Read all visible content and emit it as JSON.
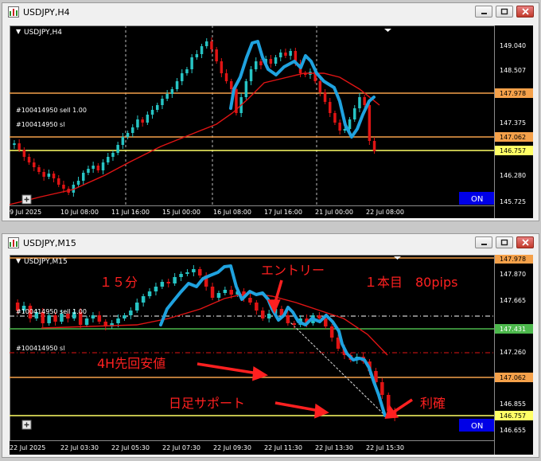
{
  "colors": {
    "accent_line": "#1fa2df",
    "bull": "#27c4c4",
    "bear": "#e01414",
    "ma": "#e01414",
    "price_orange": "#f5a14a",
    "price_yellow": "#ffff66",
    "price_green": "#4cb84c",
    "on_button": "#0000e6"
  },
  "window_top": {
    "title": "USDJPY,H4",
    "label": "USDJPY,H4",
    "order_label": "#100414950 sell 1.00",
    "sl_label": "#100414950 sl",
    "on_button": "ON",
    "price_axis": [
      "149.040",
      "148.507",
      "147.978",
      "147.375",
      "147.062",
      "146.757",
      "146.280",
      "145.725"
    ],
    "time_axis": [
      "9 Jul 2025",
      "10 Jul 08:00",
      "11 Jul 16:00",
      "15 Jul 00:00",
      "16 Jul 08:00",
      "17 Jul 16:00",
      "21 Jul 00:00",
      "22 Jul 08:00"
    ],
    "highlighted_prices": {
      "p1": "147.978",
      "p2": "147.062",
      "p3": "146.757"
    }
  },
  "window_bottom": {
    "title": "USDJPY,M15",
    "label": "USDJPY,M15",
    "order_label": "#100414950 sell 1.00",
    "sl_label": "#100414950 sl",
    "on_button": "ON",
    "price_axis": [
      "147.978",
      "147.870",
      "147.665",
      "147.431",
      "147.260",
      "147.062",
      "146.855",
      "146.757",
      "146.655"
    ],
    "time_axis": [
      "22 Jul 2025",
      "22 Jul 03:30",
      "22 Jul 05:30",
      "22 Jul 07:30",
      "22 Jul 09:30",
      "22 Jul 11:30",
      "22 Jul 13:30",
      "22 Jul 15:30"
    ],
    "highlighted_prices": {
      "p1": "147.978",
      "p2": "147.431",
      "p3": "147.062",
      "p4": "146.757"
    },
    "annotations": {
      "fifteen_min": "１５分",
      "entry": "エントリー",
      "first_bar": "１本目　80pips",
      "h4_low": "4H先回安値",
      "daily_support": "日足サポート",
      "take_profit": "利確"
    }
  }
}
